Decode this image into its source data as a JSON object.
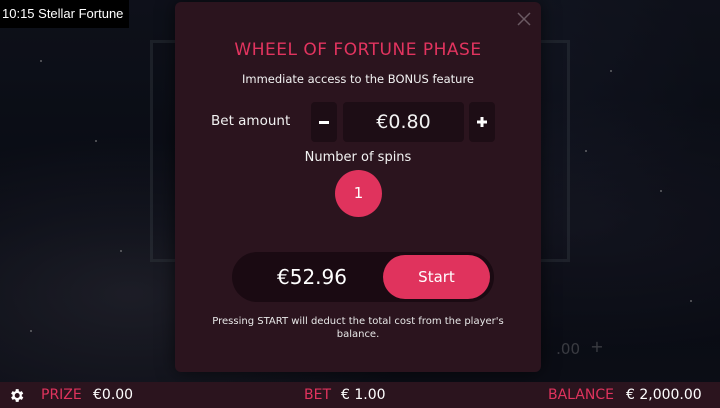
{
  "title_tag": "10:15 Stellar Fortune",
  "background": {
    "bet_value": ".00",
    "plus_icon": "plus-icon"
  },
  "modal": {
    "title": "WHEEL OF FORTUNE PHASE",
    "subtitle": "Immediate access to the BONUS feature",
    "bet_label": "Bet amount",
    "bet_value": "€0.80",
    "minus_icon": "minus-icon",
    "plus_icon": "plus-icon",
    "spins_label": "Number of spins",
    "spins_value": "1",
    "total_value": "€52.96",
    "start_label": "Start",
    "footnote": "Pressing START will deduct the total cost from the player's balance.",
    "close_icon": "close-icon"
  },
  "bottom_bar": {
    "settings_icon": "gear-icon",
    "prize_label": "PRIZE",
    "prize_value": "€0.00",
    "bet_label": "BET",
    "bet_value": "€ 1.00",
    "balance_label": "BALANCE",
    "balance_value": "€ 2,000.00"
  },
  "colors": {
    "accent": "#e0335d",
    "modal_bg": "#2b141e",
    "field_bg": "#1d0d15"
  }
}
